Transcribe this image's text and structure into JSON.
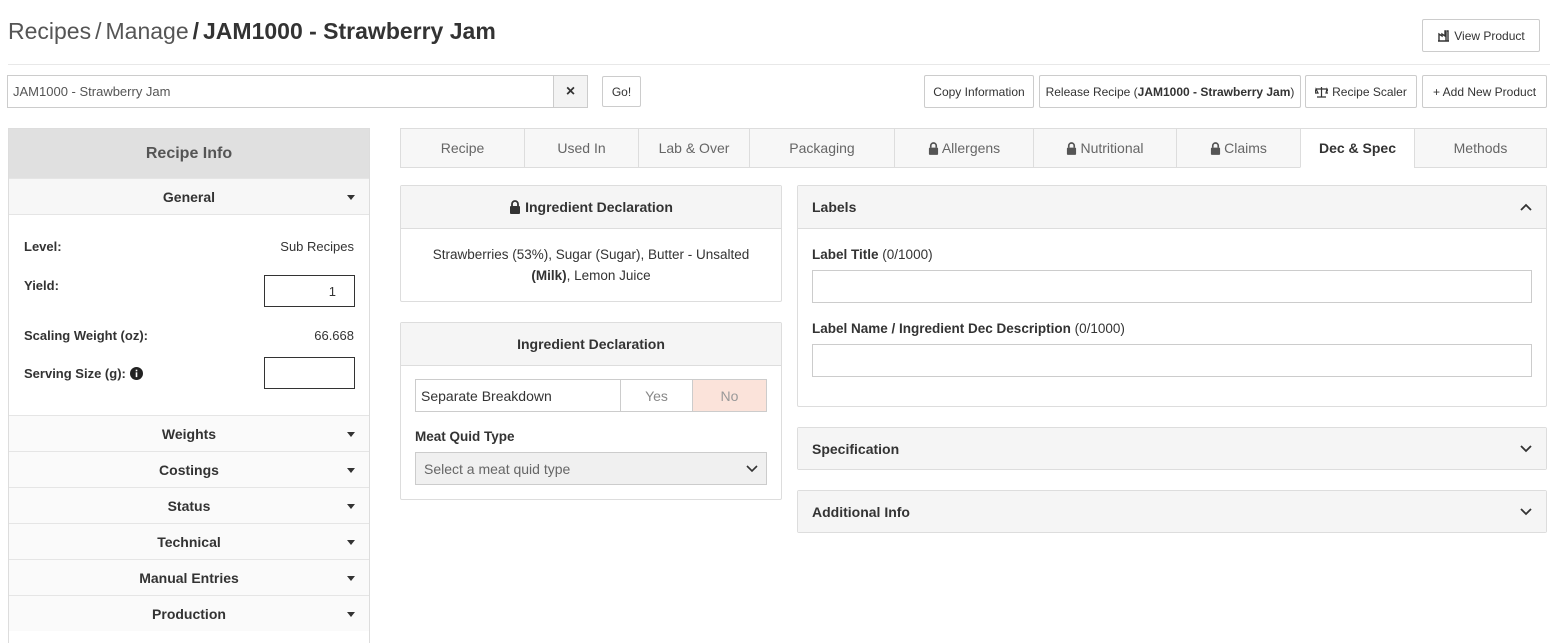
{
  "header": {
    "breadcrumb_1": "Recipes",
    "breadcrumb_sep": "/",
    "breadcrumb_2": "Manage",
    "title": "JAM1000 - Strawberry Jam",
    "view_product": "View Product"
  },
  "search": {
    "value": "JAM1000 - Strawberry Jam",
    "clear": "×",
    "go": "Go!"
  },
  "toolbar": {
    "copy_information": "Copy Information",
    "release_prefix": "Release Recipe (",
    "release_name": "JAM1000 - Strawberry Jam",
    "release_suffix": ")",
    "recipe_scaler": "Recipe Scaler",
    "add_new_product": "+ Add New Product"
  },
  "sidebar": {
    "title": "Recipe Info",
    "general": "General",
    "fields": {
      "level_label": "Level:",
      "level_value": "Sub Recipes",
      "yield_label": "Yield:",
      "yield_value": "1",
      "scaling_label": "Scaling Weight (oz):",
      "scaling_value": "66.668",
      "serving_label": "Serving Size (g):",
      "serving_value": ""
    },
    "sections": [
      "Weights",
      "Costings",
      "Status",
      "Technical",
      "Manual Entries",
      "Production"
    ]
  },
  "tabs": [
    {
      "label": "Recipe",
      "locked": false,
      "active": false
    },
    {
      "label": "Used In",
      "locked": false,
      "active": false
    },
    {
      "label": "Lab & Over",
      "locked": false,
      "active": false
    },
    {
      "label": "Packaging",
      "locked": false,
      "active": false
    },
    {
      "label": "Allergens",
      "locked": true,
      "active": false
    },
    {
      "label": "Nutritional",
      "locked": true,
      "active": false
    },
    {
      "label": "Claims",
      "locked": true,
      "active": false
    },
    {
      "label": "Dec & Spec",
      "locked": false,
      "active": true
    },
    {
      "label": "Methods",
      "locked": false,
      "active": false
    }
  ],
  "declaration_panel": {
    "title": "Ingredient Declaration",
    "text_part1": "Strawberries (53%), Sugar (Sugar), Butter - Unsalted",
    "text_bold": "(Milk)",
    "text_part2": ", Lemon Juice"
  },
  "declaration_settings": {
    "title": "Ingredient Declaration",
    "separate_breakdown": "Separate Breakdown",
    "yes": "Yes",
    "no": "No",
    "meat_quid_label": "Meat Quid Type",
    "meat_quid_placeholder": "Select a meat quid type"
  },
  "labels_panel": {
    "title": "Labels",
    "label_title": "Label Title",
    "label_title_count": "(0/1000)",
    "label_name": "Label Name / Ingredient Dec Description",
    "label_name_count": "(0/1000)"
  },
  "specification": {
    "title": "Specification"
  },
  "additional_info": {
    "title": "Additional Info"
  },
  "colors": {
    "no_selected_bg": "#fbe3da",
    "panel_header_bg": "#f5f5f5",
    "sidebar_header_bg": "#e0e0e0"
  }
}
